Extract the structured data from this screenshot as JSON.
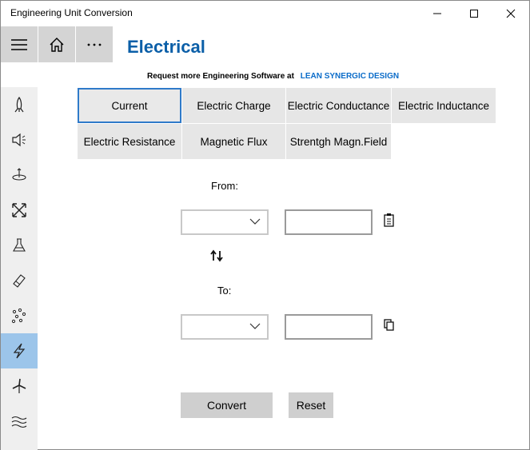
{
  "window": {
    "title": "Engineering Unit Conversion"
  },
  "header": {
    "page_title": "Electrical"
  },
  "promo": {
    "text": "Request more Engineering Software at",
    "link": "LEAN SYNERGIC DESIGN"
  },
  "units": [
    {
      "label": "Current",
      "selected": true
    },
    {
      "label": "Electric Charge",
      "selected": false
    },
    {
      "label": "Electric Conductance",
      "selected": false
    },
    {
      "label": "Electric Inductance",
      "selected": false
    },
    {
      "label": "Electric Resistance",
      "selected": false
    },
    {
      "label": "Magnetic Flux",
      "selected": false
    },
    {
      "label": "Strentgh Magn.Field",
      "selected": false
    }
  ],
  "converter": {
    "from_label": "From:",
    "to_label": "To:",
    "from_unit": "",
    "from_value": "",
    "to_unit": "",
    "to_value": ""
  },
  "actions": {
    "convert_label": "Convert",
    "reset_label": "Reset"
  },
  "sidebar": {
    "items": [
      {
        "icon": "rocket-icon"
      },
      {
        "icon": "speaker-icon"
      },
      {
        "icon": "rotation-axis-icon"
      },
      {
        "icon": "arrows-cross-icon"
      },
      {
        "icon": "flask-icon"
      },
      {
        "icon": "eraser-icon"
      },
      {
        "icon": "particles-icon"
      },
      {
        "icon": "lightning-icon",
        "active": true
      },
      {
        "icon": "wind-turbine-icon"
      },
      {
        "icon": "waves-icon"
      }
    ]
  },
  "colors": {
    "accent": "#0b5fa8",
    "link": "#0b6cc9",
    "sidebar_active": "#9cc5ea",
    "button_gray": "#e6e6e6"
  }
}
